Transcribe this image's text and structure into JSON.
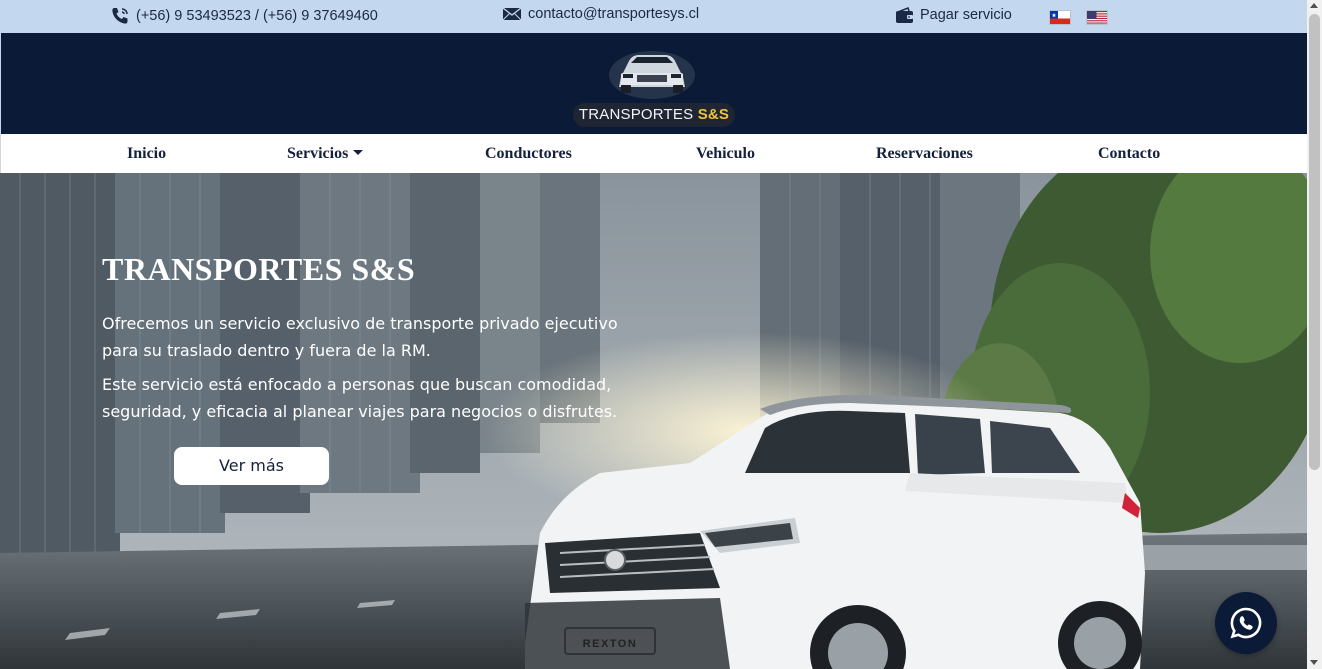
{
  "topbar": {
    "phone": "(+56) 9 53493523 / (+56) 9 37649460",
    "email": "contacto@transportesys.cl",
    "pay": "Pagar servicio",
    "icons": [
      "phone-icon",
      "envelope-icon",
      "wallet-icon",
      "flag-chile-icon",
      "flag-usa-icon"
    ]
  },
  "logo": {
    "name": "TRANSPORTES",
    "mark": "S&S"
  },
  "nav": {
    "items": [
      {
        "label": "Inicio"
      },
      {
        "label": "Servicios"
      },
      {
        "label": "Conductores"
      },
      {
        "label": "Vehiculo"
      },
      {
        "label": "Reservaciones"
      },
      {
        "label": "Contacto"
      }
    ]
  },
  "hero": {
    "title": "TRANSPORTES S&S",
    "paragraph1": "Ofrecemos un servicio exclusivo de transporte privado ejecutivo para su traslado dentro y fuera de la RM.",
    "paragraph2": "Este servicio está enfocado a personas que buscan comodidad, seguridad, y eficacia al planear viajes para negocios o disfrutes.",
    "cta": "Ver más",
    "plate": "REXTON"
  },
  "colors": {
    "topbar": "#c3d7ee",
    "header": "#0b1a36",
    "accent": "#f0c23c",
    "nav_text": "#14213d"
  }
}
